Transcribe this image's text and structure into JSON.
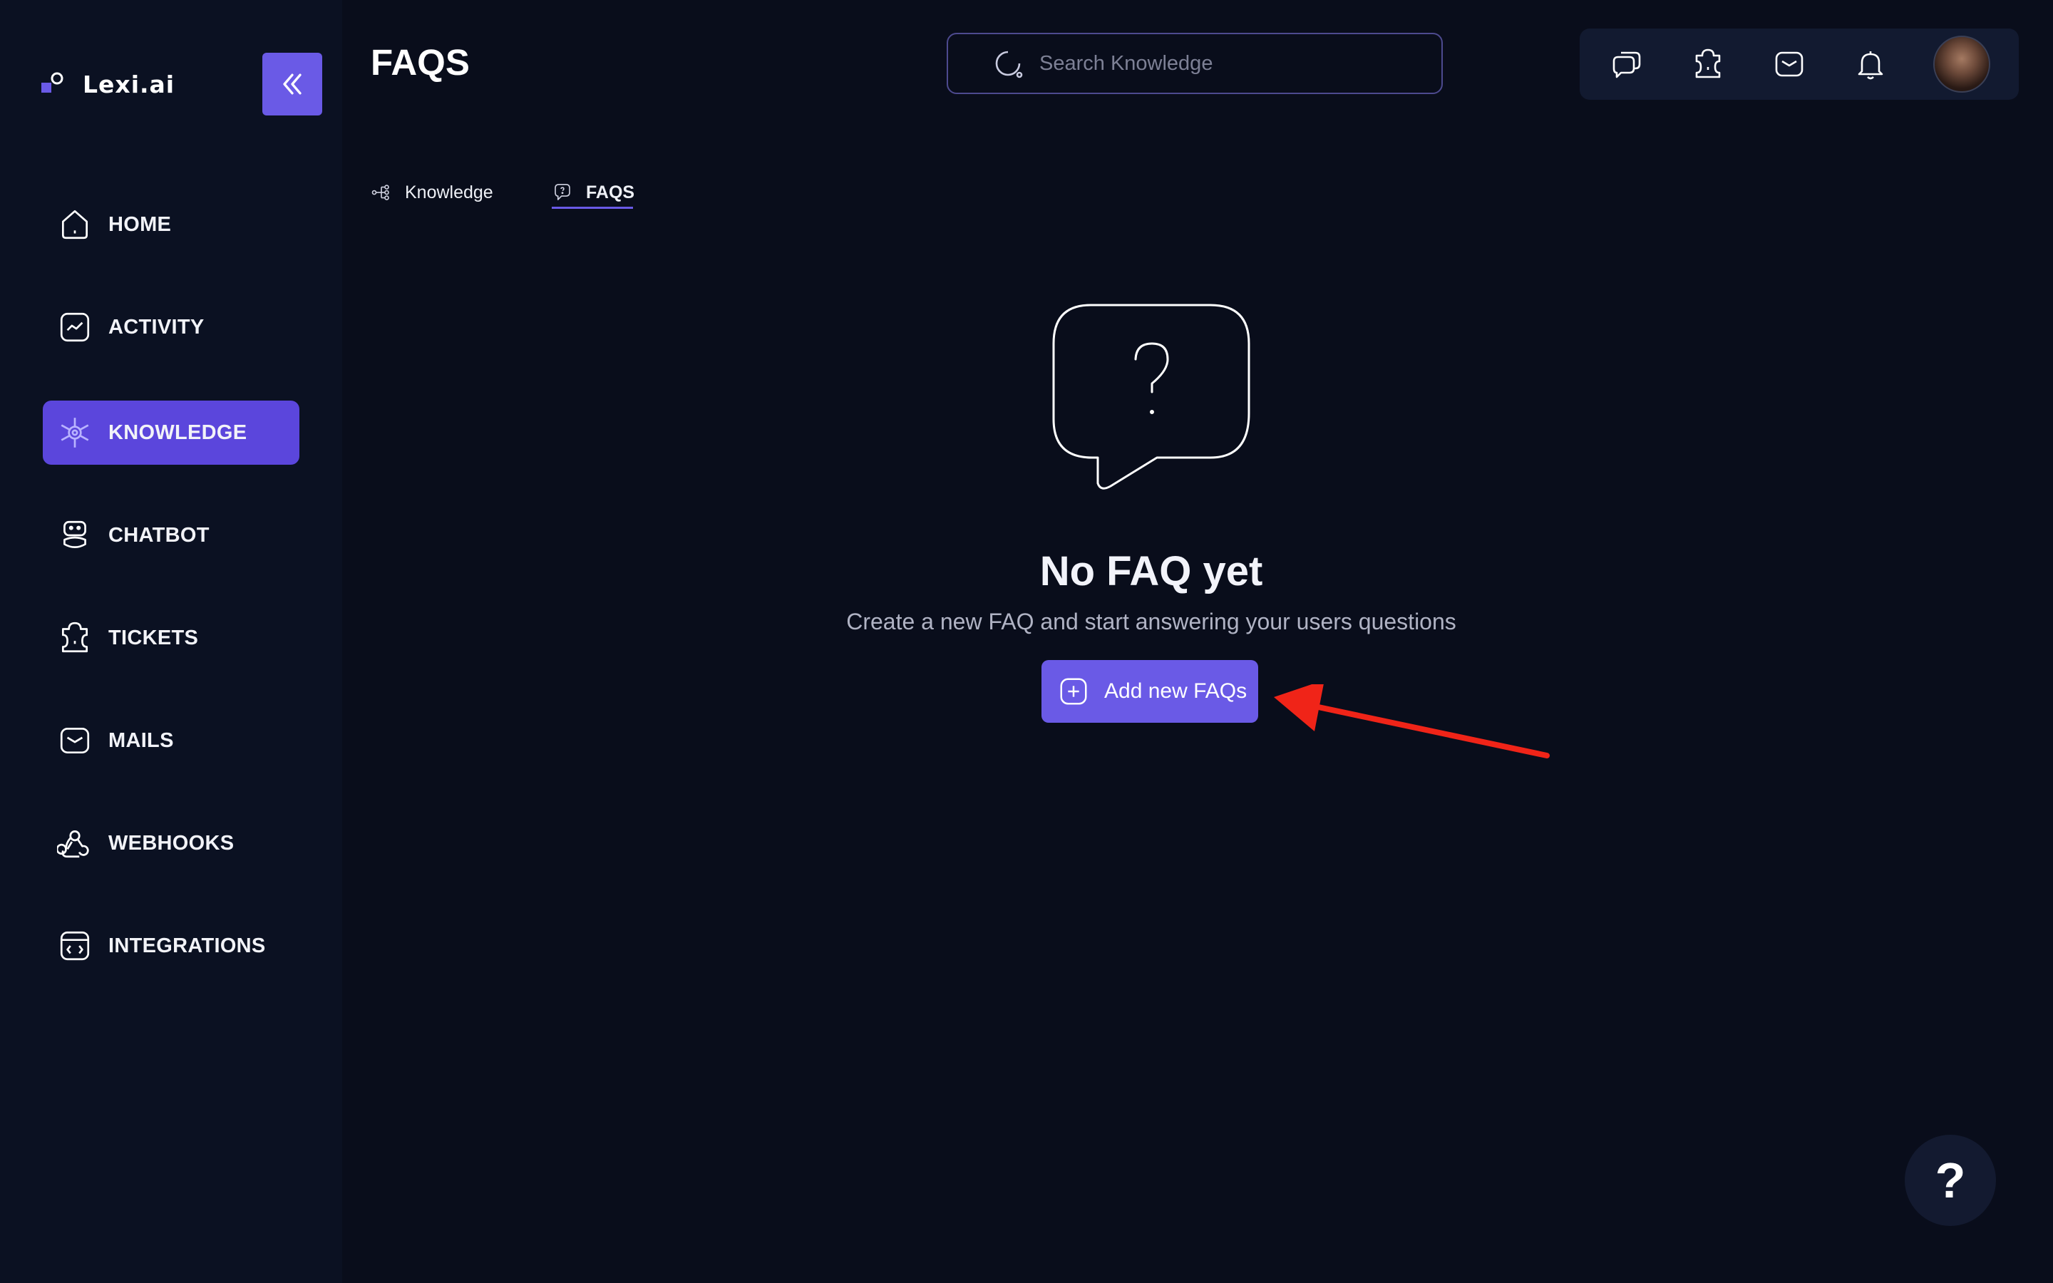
{
  "app": {
    "name": "Lexi.ai",
    "brand_color": "#6a5ae6"
  },
  "sidebar": {
    "collapse_icon": "chevrons-left-icon",
    "items": [
      {
        "label": "HOME",
        "icon": "home-icon",
        "active": false
      },
      {
        "label": "ACTIVITY",
        "icon": "activity-chart-icon",
        "active": false
      },
      {
        "label": "KNOWLEDGE",
        "icon": "knowledge-network-icon",
        "active": true
      },
      {
        "label": "CHATBOT",
        "icon": "robot-icon",
        "active": false
      },
      {
        "label": "TICKETS",
        "icon": "ticket-icon",
        "active": false
      },
      {
        "label": "MAILS",
        "icon": "mail-icon",
        "active": false
      },
      {
        "label": "WEBHOOKS",
        "icon": "webhook-icon",
        "active": false
      },
      {
        "label": "INTEGRATIONS",
        "icon": "code-window-icon",
        "active": false
      }
    ]
  },
  "header": {
    "title": "FAQS",
    "search": {
      "placeholder": "Search Knowledge",
      "value": ""
    },
    "actions": [
      "chat-bubbles-icon",
      "ticket-icon",
      "mail-icon",
      "bell-icon"
    ]
  },
  "tabs": [
    {
      "label": "Knowledge",
      "icon": "tree-structure-icon",
      "active": false
    },
    {
      "label": "FAQS",
      "icon": "question-bubble-icon",
      "active": true
    }
  ],
  "empty_state": {
    "title": "No FAQ yet",
    "subtitle": "Create a new FAQ and start answering your users questions",
    "button_label": "Add new FAQs",
    "illustration": "question-speech-bubble-icon"
  },
  "help_button": {
    "label": "?"
  },
  "annotation": {
    "arrow_color": "#f02418"
  }
}
